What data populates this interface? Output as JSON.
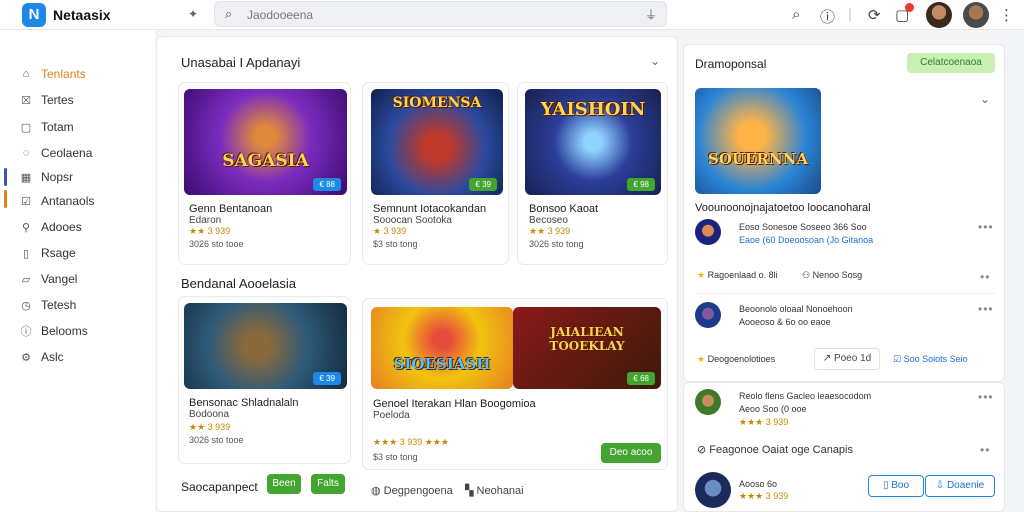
{
  "header": {
    "app_name": "Netaasix",
    "logo_glyph": "N",
    "search_value": "Jaodooeena"
  },
  "sidebar": {
    "items": [
      {
        "label": "Tenlants",
        "icon": "home-icon",
        "active": true
      },
      {
        "label": "Tertes",
        "icon": "list-icon"
      },
      {
        "label": "Totam",
        "icon": "box-icon"
      },
      {
        "label": "Ceolaena",
        "icon": "chat-icon"
      },
      {
        "label": "Nopsr",
        "icon": "grid-icon"
      },
      {
        "label": "Antanaols",
        "icon": "checklist-icon"
      },
      {
        "label": "Adooes",
        "icon": "pin-icon"
      },
      {
        "label": "Rsage",
        "icon": "doc-icon"
      },
      {
        "label": "Vangel",
        "icon": "bookmark-icon"
      },
      {
        "label": "Tetesh",
        "icon": "clock-icon"
      },
      {
        "label": "Belooms",
        "icon": "info-icon"
      },
      {
        "label": "Aslc",
        "icon": "settings-icon"
      }
    ]
  },
  "main": {
    "section1_title": "Unasabai I Apdanayi",
    "section2_title": "Bendanal Aooelasia",
    "games_row1": [
      {
        "art": "SAGASIA",
        "price": "€ 88",
        "title": "Genn Bentanoan",
        "sub": "Edaron",
        "rating": "★★ 3 939",
        "meta": "3026 sto tooe"
      },
      {
        "art": "SIOMENSA",
        "price": "€ 39",
        "title": "Semnunt Iotacokandan",
        "sub": "Sooocan Sootoka",
        "rating": "★ 3 939",
        "meta": "$3 sto tong"
      },
      {
        "art": "YAISHOIN",
        "price": "€ 98",
        "title": "Bonsoo Kaoat",
        "sub": "Becoseo",
        "rating": "★★ 3 939",
        "meta": "3026 sto tong"
      }
    ],
    "games_row2": [
      {
        "art": "",
        "price": "€ 39",
        "title": "Bensonac Shladnalaln",
        "sub": "Bodoona",
        "rating": "★★ 3 939",
        "meta": "3026 sto tooe"
      }
    ],
    "featured": {
      "art_left": "SIOESIASH",
      "art_right": "JAIALIEAN TOOEKLAY",
      "price": "€ 68",
      "title": "Genoel Iterakan Hlan Boogomioa",
      "sub": "Poeloda",
      "rating": "★★★ 3 939 ★★★",
      "meta": "$3 sto tong",
      "button": "Deo acoo",
      "link1": "Degpengoena",
      "link2": "Neohanai"
    },
    "bottom": {
      "label": "Saocapanpect",
      "btn1": "Been",
      "btn2": "Falts"
    }
  },
  "right": {
    "panel_title": "Dramoponsal",
    "panel_button": "Celatcoenaoa",
    "feature_art": "SOUERNNA",
    "feature_title": "Voounoonojnajatoetoo loocanoharal",
    "items": [
      {
        "title": "Eoso Sonesoe Soseeo 366 Soo",
        "sub": "Eaoe (60 Doeoosoan (Jo Gitanoa",
        "foot_left": "Ragoenlaad o. 8li",
        "foot_right": "Nenoo Sosg"
      },
      {
        "title": "Beoonolo oloaal Nonoehoon",
        "sub": "Aooeoso & 6o oo eaoe",
        "foot_left": "Deogoenolotioes",
        "foot_right": "Soo Soiots Seio",
        "action": "Poeo 1d"
      }
    ],
    "panel2_item": {
      "title": "Reolo flens Gacleo leaesocodom",
      "sub": "Aeoo Soo (0 ooe",
      "rating": "★★★ 3 939",
      "link": "Feagonoe Oaiat oge Canapis"
    },
    "panel2_bottom": {
      "title": "Aooso 6o",
      "sub": "★★★ 3 939",
      "btn1": "Boo",
      "btn2": "Doaenie"
    }
  },
  "colors": {
    "accent": "#e67e22",
    "brand": "#1e88e5",
    "green": "#43a52f"
  }
}
